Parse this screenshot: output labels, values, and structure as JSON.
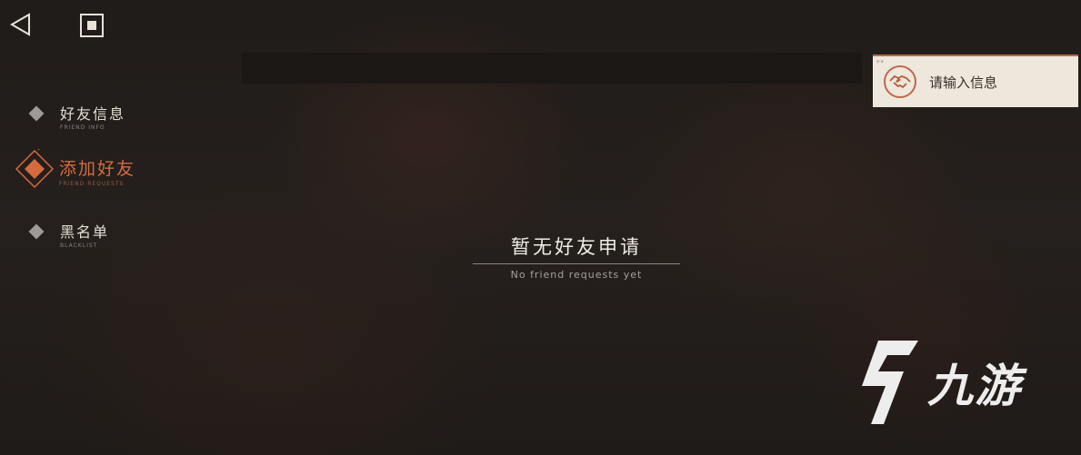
{
  "nav": {
    "back_icon": "back-triangle-icon",
    "home_icon": "stop-square-icon",
    "items": [
      {
        "label": "好友信息",
        "sublabel": "FRIEND INFO",
        "active": false
      },
      {
        "label": "添加好友",
        "sublabel": "FRIEND REQUESTS",
        "active": true
      },
      {
        "label": "黑名单",
        "sublabel": "BLACKLIST",
        "active": false
      }
    ]
  },
  "search": {
    "placeholder": "请输入信息",
    "icon": "handshake-icon"
  },
  "empty_state": {
    "title": "暂无好友申请",
    "subtitle": "No friend requests yet"
  },
  "watermark": {
    "text": "九游",
    "icon": "jiuyou-logo-icon"
  },
  "colors": {
    "accent": "#d66a3c",
    "panel": "#eee7dc",
    "background": "#231f1c"
  }
}
